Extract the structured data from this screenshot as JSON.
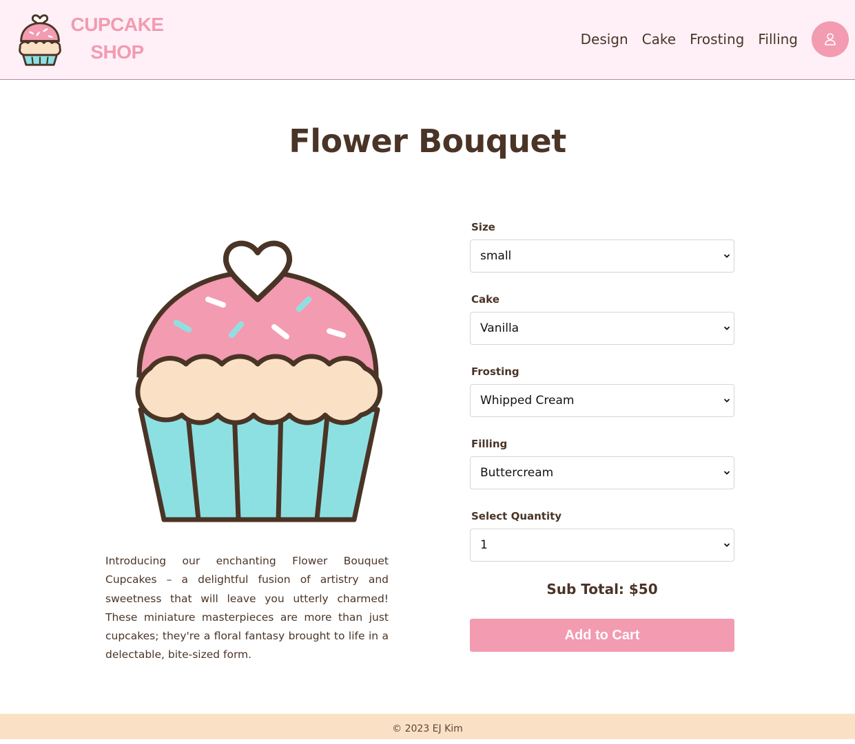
{
  "brand": {
    "name_line1": "CUPCAKE",
    "name_line2": "SHOP",
    "logo_icon": "cupcake-icon",
    "color": "#f29bb1"
  },
  "nav": {
    "items": [
      {
        "label": "Design"
      },
      {
        "label": "Cake"
      },
      {
        "label": "Frosting"
      },
      {
        "label": "Filling"
      }
    ],
    "account_icon": "user-icon"
  },
  "product": {
    "title": "Flower Bouquet",
    "image_icon": "cupcake-illustration",
    "description": "Introducing our enchanting Flower Bouquet Cupcakes – a delightful fusion of artistry and sweetness that will leave you utterly charmed! These miniature masterpieces are more than just cupcakes; they're a floral fantasy brought to life in a delectable, bite-sized form."
  },
  "form": {
    "fields": [
      {
        "label": "Size",
        "value": "small"
      },
      {
        "label": "Cake",
        "value": "Vanilla"
      },
      {
        "label": "Frosting",
        "value": "Whipped Cream"
      },
      {
        "label": "Filling",
        "value": "Buttercream"
      },
      {
        "label": "Select Quantity",
        "value": "1"
      }
    ],
    "subtotal": "Sub Total: $50",
    "add_to_cart_label": "Add to Cart"
  },
  "footer": {
    "text": "© 2023 EJ Kim"
  },
  "colors": {
    "accent_pink": "#f29bb1",
    "header_bg": "#fff0f7",
    "text_brown": "#4a3426",
    "footer_bg": "#fae1c6",
    "liner_teal": "#8de0e2"
  }
}
